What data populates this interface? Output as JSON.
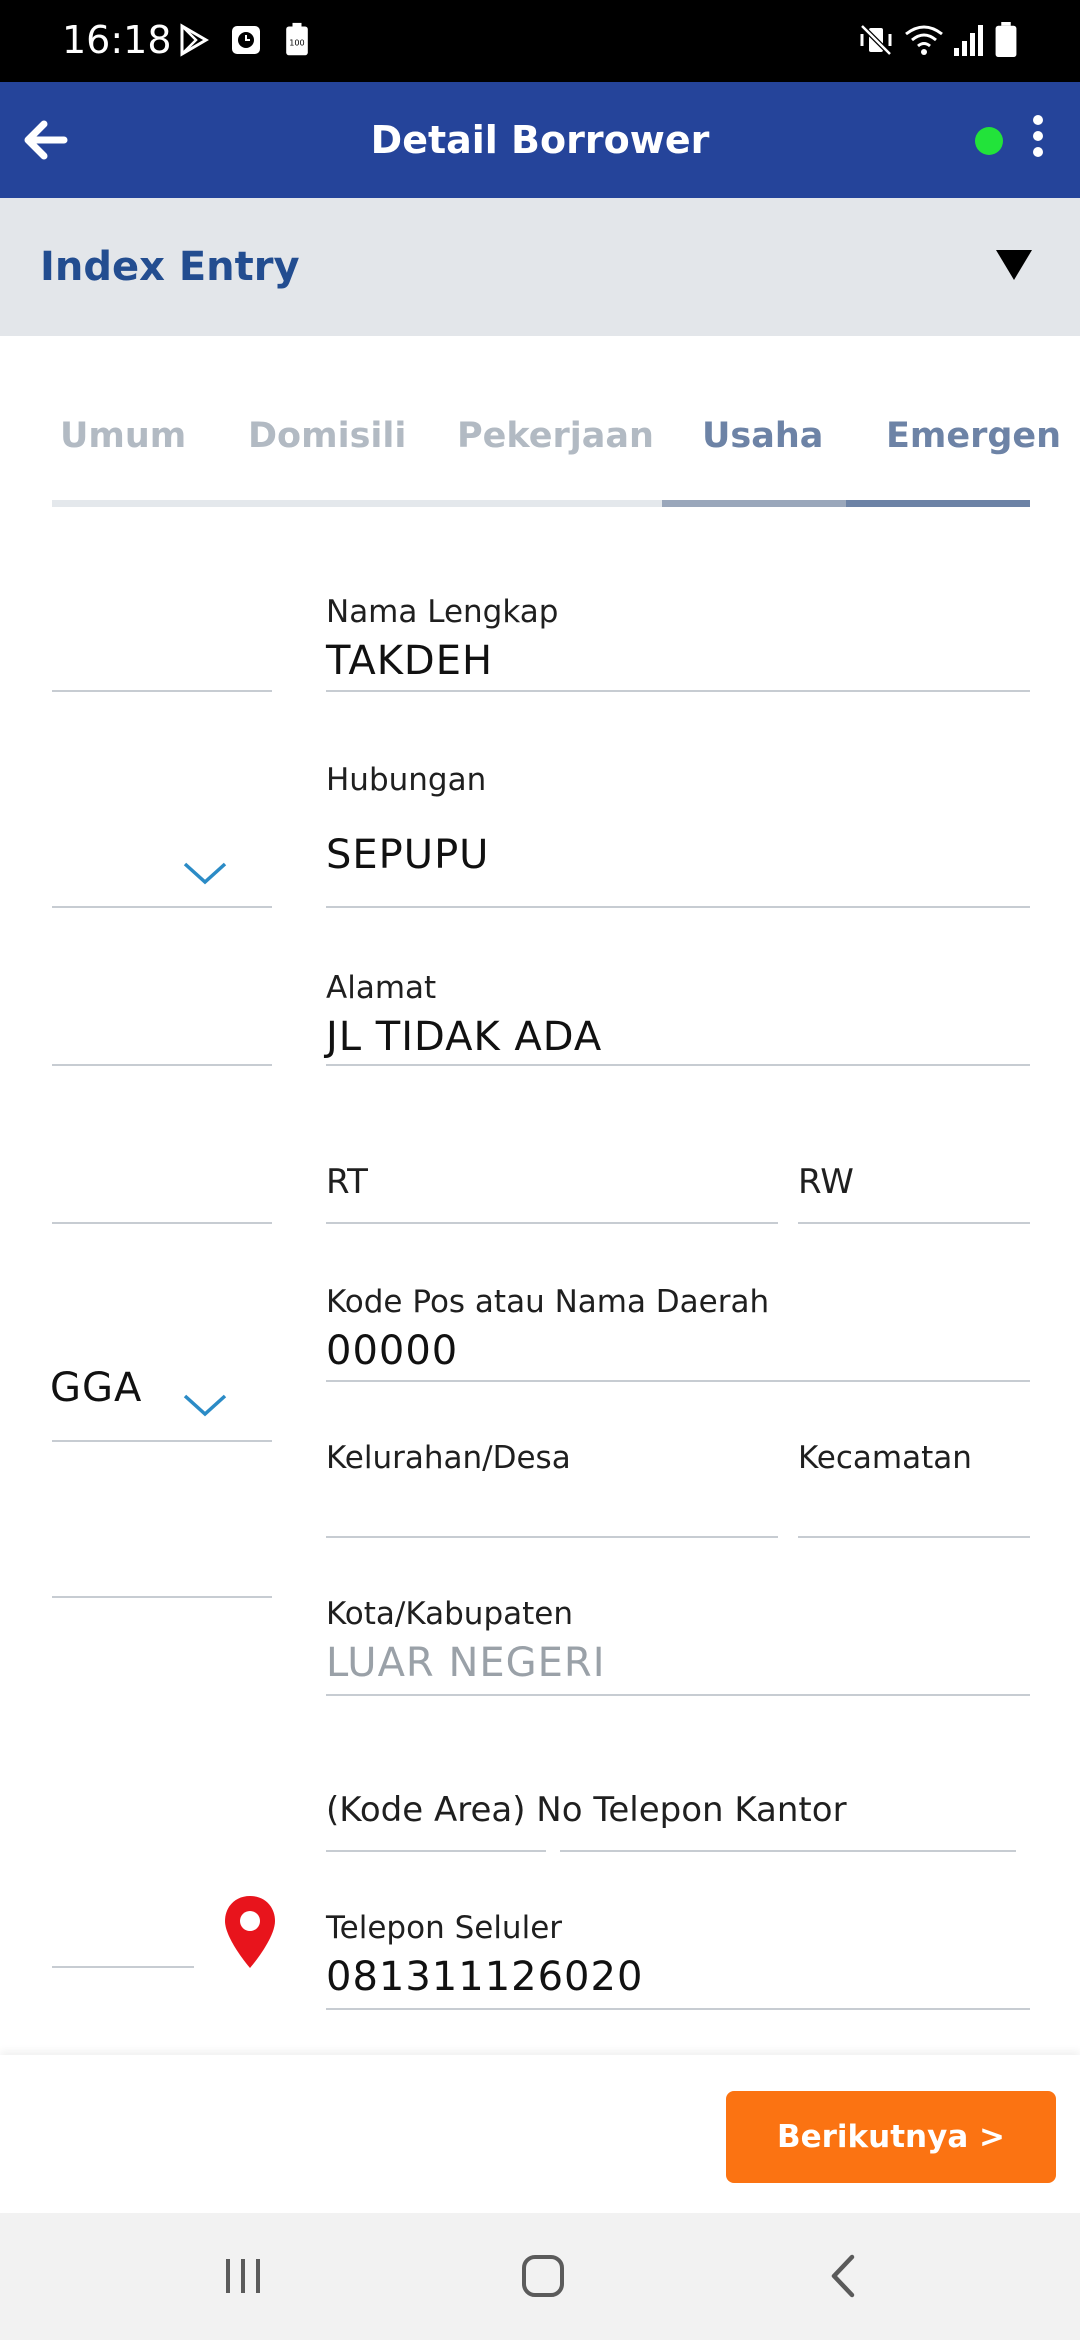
{
  "status_bar": {
    "time": "16:18",
    "battery_badge": "100"
  },
  "app_bar": {
    "title": "Detail Borrower",
    "status_color": "#22e33a"
  },
  "section": {
    "label": "Index Entry"
  },
  "tabs": [
    "Umum",
    "Domisili",
    "Pekerjaan",
    "Usaha",
    "Emergen"
  ],
  "left_column": {
    "partial_value": "GGA"
  },
  "form": {
    "nama_lengkap": {
      "label": "Nama Lengkap",
      "value": "TAKDEH"
    },
    "hubungan": {
      "label": "Hubungan",
      "value": "SEPUPU"
    },
    "alamat": {
      "label": "Alamat",
      "value": "JL TIDAK ADA"
    },
    "rt": {
      "label": "RT"
    },
    "rw": {
      "label": "RW"
    },
    "kode_pos": {
      "label": "Kode Pos atau Nama Daerah",
      "value": "00000"
    },
    "kelurahan": {
      "label": "Kelurahan/Desa"
    },
    "kecamatan": {
      "label": "Kecamatan"
    },
    "kota": {
      "label": "Kota/Kabupaten",
      "value": "LUAR NEGERI"
    },
    "telepon_kantor": {
      "label": "(Kode Area) No Telepon Kantor"
    },
    "telepon_seluler": {
      "label": "Telepon Seluler",
      "value": "081311126020"
    }
  },
  "actions": {
    "next_label": "Berikutnya >"
  },
  "colors": {
    "appbar": "#25449a",
    "accent": "#fb7312",
    "pin": "#e8141c",
    "chevron": "#2b8bc6"
  }
}
